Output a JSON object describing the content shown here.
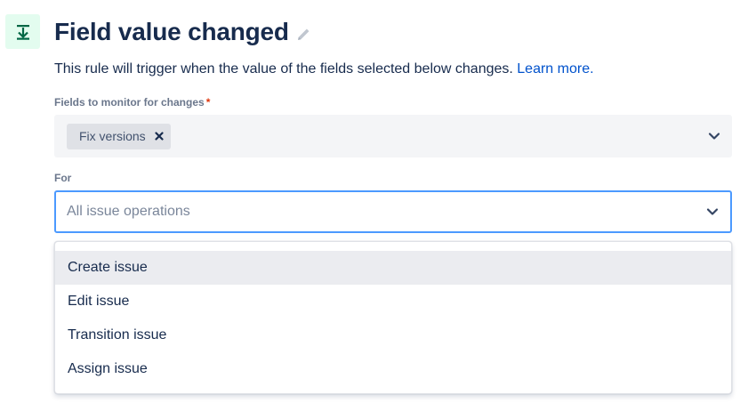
{
  "header": {
    "title": "Field value changed",
    "icon": "download-arrow-icon",
    "icon_color": "#006644",
    "icon_bg": "#e3fcef"
  },
  "description": {
    "text": "This rule will trigger when the value of the fields selected below changes. ",
    "link_text": "Learn more."
  },
  "fields_monitor": {
    "label": "Fields to monitor for changes",
    "required_mark": "*",
    "tags": [
      "Fix versions"
    ]
  },
  "for_select": {
    "label": "For",
    "placeholder": "All issue operations",
    "options": [
      "Create issue",
      "Edit issue",
      "Transition issue",
      "Assign issue"
    ]
  },
  "colors": {
    "link": "#0052cc",
    "focus_border": "#4c9aff",
    "required": "#de350b"
  }
}
